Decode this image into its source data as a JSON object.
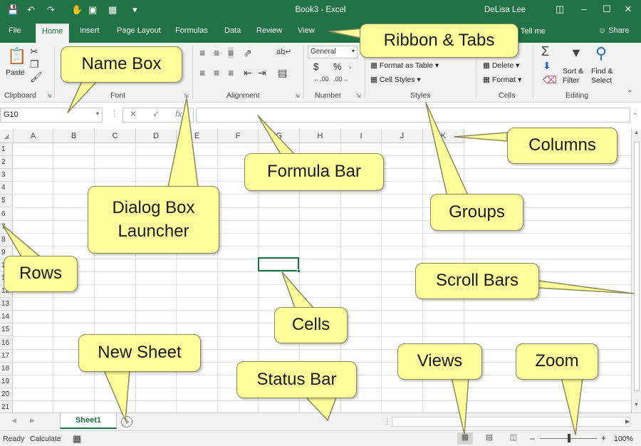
{
  "titlebar": {
    "doc_title": "Book3  -  Excel",
    "user": "DeLisa Lee",
    "qat_icons": [
      "save-icon",
      "undo-icon",
      "redo-icon",
      "customize-icon"
    ]
  },
  "tabs": [
    "File",
    "Home",
    "Insert",
    "Page Layout",
    "Formulas",
    "Data",
    "Review",
    "View"
  ],
  "active_tab": "Home",
  "tell_me": "Tell me",
  "share": "Share",
  "ribbon": {
    "clipboard": {
      "paste": "Paste",
      "label": "Clipboard"
    },
    "font": {
      "label": "Font"
    },
    "alignment": {
      "label": "Alignment"
    },
    "number": {
      "format": "General",
      "currency": "$",
      "percent": "%",
      "label": "Number"
    },
    "styles": {
      "format_as_table": "Format as Table",
      "cell_styles": "Cell Styles",
      "label": "Styles"
    },
    "cells": {
      "delete": "Delete",
      "format": "Format",
      "label": "Cells"
    },
    "editing": {
      "sort_filter": "Sort & Filter",
      "find_select": "Find & Select",
      "label": "Editing"
    }
  },
  "namebox": {
    "value": "G10"
  },
  "formula": {
    "fx": "fx",
    "value": ""
  },
  "columns": [
    "A",
    "B",
    "C",
    "D",
    "E",
    "F",
    "G",
    "H",
    "I",
    "J",
    "K"
  ],
  "rows": [
    "1",
    "2",
    "3",
    "4",
    "5",
    "6",
    "7",
    "8",
    "9",
    "10",
    "11",
    "12",
    "13",
    "14",
    "15",
    "16",
    "17",
    "18",
    "19",
    "20",
    "21"
  ],
  "sheet": {
    "name": "Sheet1"
  },
  "status": {
    "ready": "Ready",
    "calculate": "Calculate",
    "zoom": "100%"
  },
  "callouts": {
    "ribbon_tabs": "Ribbon & Tabs",
    "name_box": "Name Box",
    "columns": "Columns",
    "formula_bar": "Formula Bar",
    "dialog_box_launcher": "Dialog Box\nLauncher",
    "groups": "Groups",
    "rows": "Rows",
    "scroll_bars": "Scroll Bars",
    "cells": "Cells",
    "new_sheet": "New Sheet",
    "status_bar": "Status Bar",
    "views": "Views",
    "zoom": "Zoom"
  },
  "colors": {
    "excel_green": "#217346",
    "callout_fill": "#fefe9c"
  }
}
